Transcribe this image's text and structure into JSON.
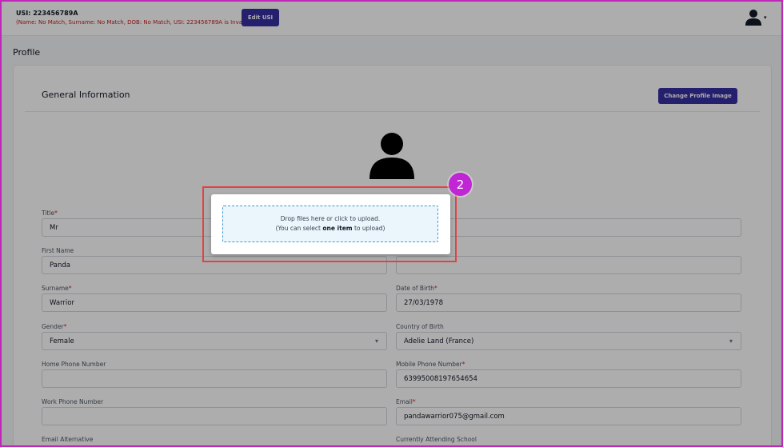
{
  "header": {
    "usi_title": "USI: 223456789A",
    "usi_error": "(Name: No Match, Surname: No Match, DOB: No Match, USI: 223456789A is Invalid)",
    "edit_usi_label": "Edit USI",
    "user_icon": "user-icon",
    "caret_glyph": "▾"
  },
  "page": {
    "title": "Profile"
  },
  "card": {
    "title": "General Information",
    "change_image_label": "Change Profile Image",
    "avatar_icon": "user-silhouette-icon"
  },
  "fields": {
    "title": {
      "label": "Title",
      "required_mark": "*",
      "value": "Mr"
    },
    "first_name": {
      "label": "First Name",
      "value": "Panda"
    },
    "surname": {
      "label": "Surname",
      "required_mark": "*",
      "value": "Warrior"
    },
    "date_of_birth": {
      "label": "Date of Birth",
      "required_mark": "*",
      "value": "27/03/1978"
    },
    "gender": {
      "label": "Gender",
      "required_mark": "*",
      "value": "Female"
    },
    "country_of_birth": {
      "label": "Country of Birth",
      "value": "Adelie Land (France)"
    },
    "home_phone": {
      "label": "Home Phone Number",
      "value": ""
    },
    "mobile_phone": {
      "label": "Mobile Phone Number",
      "required_mark": "*",
      "value": "63995008197654654"
    },
    "work_phone": {
      "label": "Work Phone Number",
      "value": ""
    },
    "email": {
      "label": "Email",
      "required_mark": "*",
      "value": "pandawarrior075@gmail.com"
    },
    "email_alternative": {
      "label": "Email Alternative"
    },
    "currently_attending_school": {
      "label": "Currently Attending School"
    }
  },
  "modal": {
    "line1": "Drop files here or click to upload.",
    "line2_prefix": "(You can select ",
    "line2_bold": "one item",
    "line2_suffix": " to upload)"
  },
  "annotation": {
    "step_number": "2"
  },
  "colors": {
    "primary": "#3730a3",
    "error": "#c81e1e",
    "required": "#dc2626",
    "highlight": "#e04343",
    "badge": "#c026d3",
    "dropzone_border": "#3b9bd6",
    "dropzone_bg": "#eaf6fb"
  }
}
